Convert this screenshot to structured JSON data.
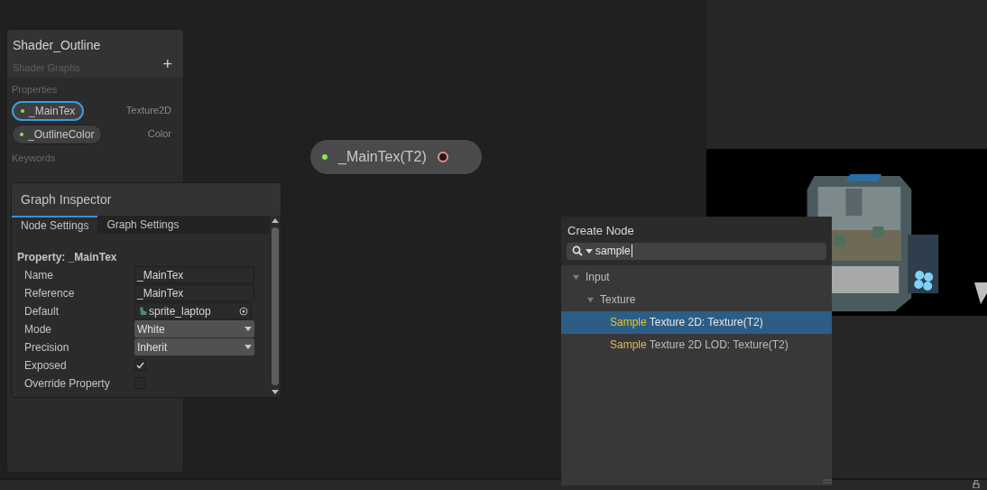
{
  "blackboard": {
    "title": "Shader_Outline",
    "subtitle": "Shader Graphs",
    "add_button": "+",
    "properties_label": "Properties",
    "properties": [
      {
        "name": "_MainTex",
        "type": "Texture2D",
        "selected": true
      },
      {
        "name": "_OutlineColor",
        "type": "Color",
        "selected": false
      }
    ],
    "keywords_label": "Keywords"
  },
  "inspector": {
    "title": "Graph Inspector",
    "tabs": [
      {
        "label": "Node Settings",
        "selected": true
      },
      {
        "label": "Graph Settings",
        "selected": false
      }
    ],
    "heading": "Property: _MainTex",
    "fields": [
      {
        "kind": "text",
        "label": "Name",
        "value": "_MainTex"
      },
      {
        "kind": "text",
        "label": "Reference",
        "value": "_MainTex"
      },
      {
        "kind": "object",
        "label": "Default",
        "value": "sprite_laptop"
      },
      {
        "kind": "dropdown",
        "label": "Mode",
        "value": "White"
      },
      {
        "kind": "dropdown",
        "label": "Precision",
        "value": "Inherit"
      },
      {
        "kind": "checkbox",
        "label": "Exposed",
        "checked": true
      },
      {
        "kind": "checkbox",
        "label": "Override Property",
        "checked": false
      }
    ]
  },
  "node": {
    "label": "_MainTex(T2)"
  },
  "create_node": {
    "title": "Create Node",
    "search": {
      "value": "sample"
    },
    "tree": [
      {
        "label": "Input",
        "expanded": true,
        "children": [
          {
            "label": "Texture",
            "expanded": true,
            "children": [
              {
                "match": "Sample",
                "rest": " Texture 2D: Texture(T2)",
                "selected": true
              },
              {
                "match": "Sample",
                "rest": " Texture 2D LOD: Texture(T2)",
                "selected": false
              }
            ]
          }
        ]
      }
    ]
  }
}
